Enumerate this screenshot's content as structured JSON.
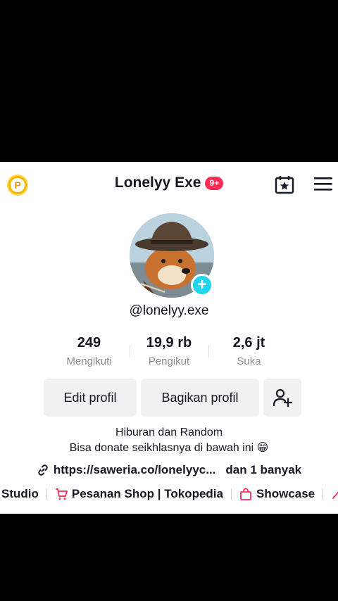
{
  "header": {
    "title": "Lonelyy Exe",
    "notification_badge": "9+",
    "coin_icon": "coin-p-icon",
    "coin_letter": "P",
    "calendar_icon": "calendar-star-icon",
    "menu_icon": "hamburger-menu-icon"
  },
  "profile": {
    "username": "@lonelyy.exe",
    "avatar_icon": "avatar-shiba-cowboy-image",
    "add_icon": "plus-icon"
  },
  "stats": [
    {
      "value": "249",
      "label": "Mengikuti"
    },
    {
      "value": "19,9 rb",
      "label": "Pengikut"
    },
    {
      "value": "2,6 jt",
      "label": "Suka"
    }
  ],
  "buttons": {
    "edit": "Edit profil",
    "share": "Bagikan profil",
    "add_friend_icon": "add-friend-icon"
  },
  "bio": {
    "line1": "Hiburan dan Random",
    "line2": "Bisa donate seikhlasnya di bawah ini 😁"
  },
  "link": {
    "url": "https://saweria.co/lonelyyc...",
    "more": "dan 1 banyak",
    "icon": "link-icon"
  },
  "shop": {
    "studio": "Studio",
    "orders": "Pesanan Shop | Tokopedia",
    "showcase": "Showcase",
    "accent": "#fe2c55"
  },
  "colors": {
    "accent": "#fe2c55",
    "teal": "#20d5ec",
    "coin": "#f5b800"
  }
}
